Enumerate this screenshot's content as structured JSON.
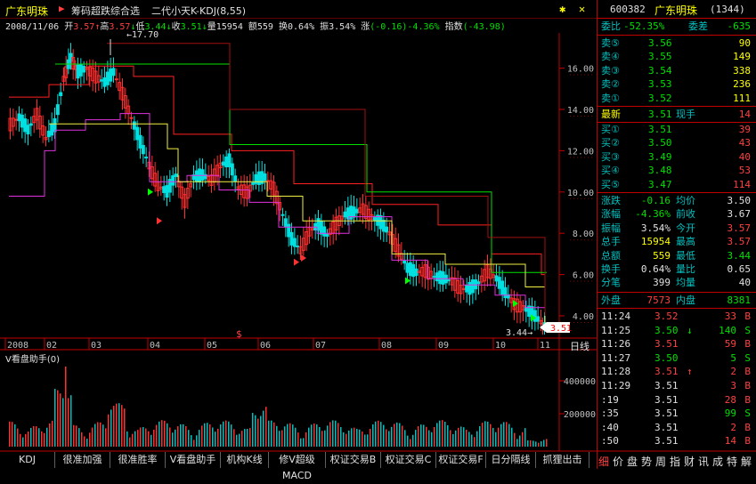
{
  "header": {
    "stock_name": "广东明珠",
    "indicator_title": "筹码超跌综合选",
    "indicator_sub": "二代小天K-KDJ(8,55)",
    "gear_icon": "settings-icon",
    "close_icon": "close-icon"
  },
  "info_bar": {
    "date": "2008/11/06",
    "open_label": "开",
    "open": "3.57",
    "high_label": "高",
    "high": "3.57",
    "low_label": "低",
    "low": "3.44",
    "close_label": "收",
    "close": "3.51",
    "volume_label": "量",
    "volume": "15954",
    "amount_label": "额",
    "amount": "559",
    "turnover_label": "换",
    "turnover": "0.64%",
    "amplitude_label": "振",
    "amplitude": "3.54%",
    "change_label": "涨",
    "change": "(-0.16)-4.36%",
    "index_label": "指数",
    "index": "(-43.98)"
  },
  "main_chart": {
    "y_ticks": [
      "16.00",
      "14.00",
      "12.00",
      "10.00",
      "8.00",
      "6.00",
      "4.00"
    ],
    "high_marker": "17.70",
    "low_marker": "3.44",
    "price_tag": "3.51",
    "dollar_marker": "$",
    "x_labels": [
      "2008",
      "02",
      "03",
      "04",
      "05",
      "06",
      "07",
      "08",
      "09",
      "10",
      "11"
    ],
    "period_label": "日线"
  },
  "volume_panel": {
    "title": "V看盘助手(0)",
    "y_ticks": [
      "400000",
      "200000"
    ]
  },
  "tabs": [
    "KDJ",
    "很准加强",
    "很准胜率",
    "V看盘助手",
    "机构K线",
    "修V超级MACD",
    "权证交易B",
    "权证交易C",
    "权证交易F",
    "日分隔线",
    "抓狸出击"
  ],
  "side_tabs": [
    "细",
    "价",
    "盘",
    "势",
    "周",
    "指",
    "财",
    "讯",
    "成",
    "特",
    "解"
  ],
  "quote": {
    "code": "600382",
    "name": "广东明珠",
    "count": "(1344)",
    "weibi_label": "委比",
    "weibi": "-52.35%",
    "weicha_label": "委差",
    "weicha": "-635",
    "sells": [
      {
        "label": "卖⑤",
        "price": "3.56",
        "vol": "90"
      },
      {
        "label": "卖④",
        "price": "3.55",
        "vol": "149"
      },
      {
        "label": "卖③",
        "price": "3.54",
        "vol": "338"
      },
      {
        "label": "卖②",
        "price": "3.53",
        "vol": "236"
      },
      {
        "label": "卖①",
        "price": "3.52",
        "vol": "111"
      }
    ],
    "last_label": "最新",
    "last": "3.51",
    "now_hand_label": "现手",
    "now_hand": "14",
    "buys": [
      {
        "label": "买①",
        "price": "3.51",
        "vol": "39"
      },
      {
        "label": "买②",
        "price": "3.50",
        "vol": "43"
      },
      {
        "label": "买③",
        "price": "3.49",
        "vol": "40"
      },
      {
        "label": "买④",
        "price": "3.48",
        "vol": "53"
      },
      {
        "label": "买⑤",
        "price": "3.47",
        "vol": "114"
      }
    ],
    "stats": [
      {
        "l1": "涨跌",
        "v1": "-0.16",
        "l2": "均价",
        "v2": "3.50",
        "c1": "g",
        "c2": "w"
      },
      {
        "l1": "涨幅",
        "v1": "-4.36%",
        "l2": "前收",
        "v2": "3.67",
        "c1": "g",
        "c2": "w"
      },
      {
        "l1": "振幅",
        "v1": "3.54%",
        "l2": "今开",
        "v2": "3.57",
        "c1": "w",
        "c2": "r"
      },
      {
        "l1": "总手",
        "v1": "15954",
        "l2": "最高",
        "v2": "3.57",
        "c1": "y",
        "c2": "r"
      },
      {
        "l1": "总额",
        "v1": "559",
        "l2": "最低",
        "v2": "3.44",
        "c1": "y",
        "c2": "g"
      },
      {
        "l1": "换手",
        "v1": "0.64%",
        "l2": "量比",
        "v2": "0.65",
        "c1": "w",
        "c2": "w"
      },
      {
        "l1": "分笔",
        "v1": "399",
        "l2": "均量",
        "v2": "40",
        "c1": "w",
        "c2": "w"
      }
    ],
    "outer_label": "外盘",
    "outer": "7573",
    "inner_label": "内盘",
    "inner": "8381",
    "ticks": [
      {
        "t": "11:24",
        "p": "3.52",
        "a": "",
        "v": "33",
        "s": "B",
        "pc": "r",
        "vc": "r"
      },
      {
        "t": "11:25",
        "p": "3.50",
        "a": "↓",
        "v": "140",
        "s": "S",
        "pc": "g",
        "vc": "g"
      },
      {
        "t": "11:26",
        "p": "3.51",
        "a": "",
        "v": "59",
        "s": "B",
        "pc": "r",
        "vc": "r"
      },
      {
        "t": "11:27",
        "p": "3.50",
        "a": "",
        "v": "5",
        "s": "S",
        "pc": "g",
        "vc": "g"
      },
      {
        "t": "11:28",
        "p": "3.51",
        "a": "↑",
        "v": "2",
        "s": "B",
        "pc": "r",
        "vc": "r"
      },
      {
        "t": "11:29",
        "p": "3.51",
        "a": "",
        "v": "3",
        "s": "B",
        "pc": "w",
        "vc": "r"
      },
      {
        "t": ":19",
        "p": "3.51",
        "a": "",
        "v": "28",
        "s": "B",
        "pc": "w",
        "vc": "r"
      },
      {
        "t": ":35",
        "p": "3.51",
        "a": "",
        "v": "99",
        "s": "S",
        "pc": "w",
        "vc": "g"
      },
      {
        "t": ":40",
        "p": "3.51",
        "a": "",
        "v": "2",
        "s": "B",
        "pc": "w",
        "vc": "r"
      },
      {
        "t": ":50",
        "p": "3.51",
        "a": "",
        "v": "14",
        "s": "B",
        "pc": "w",
        "vc": "r"
      }
    ]
  }
}
